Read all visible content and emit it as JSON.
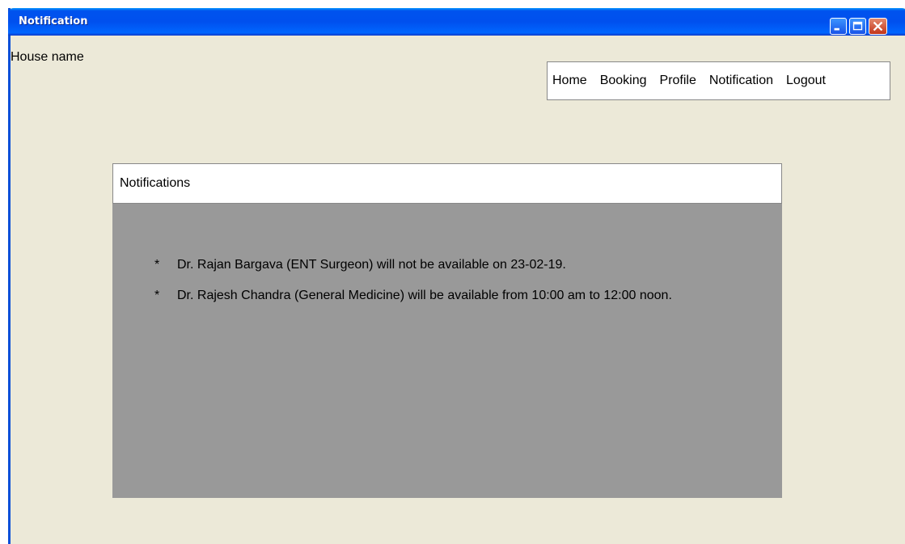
{
  "window": {
    "title": "Notification"
  },
  "header": {
    "house_name": "House name"
  },
  "nav": {
    "items": [
      {
        "label": "Home"
      },
      {
        "label": "Booking"
      },
      {
        "label": "Profile"
      },
      {
        "label": "Notification"
      },
      {
        "label": "Logout"
      }
    ]
  },
  "notifications": {
    "heading": "Notifications",
    "bullet": "*",
    "items": [
      {
        "text": "Dr. Rajan Bargava (ENT Surgeon) will not be available on 23-02-19."
      },
      {
        "text": "Dr. Rajesh Chandra (General Medicine) will be available from 10:00 am to 12:00 noon."
      }
    ]
  },
  "colors": {
    "titlebar": "#0053ee",
    "window_bg": "#ece9d8",
    "panel_bg": "#999999",
    "close_button": "#c2351a"
  },
  "icons": {
    "minimize": "minimize-icon",
    "maximize": "maximize-icon",
    "close": "close-icon"
  }
}
